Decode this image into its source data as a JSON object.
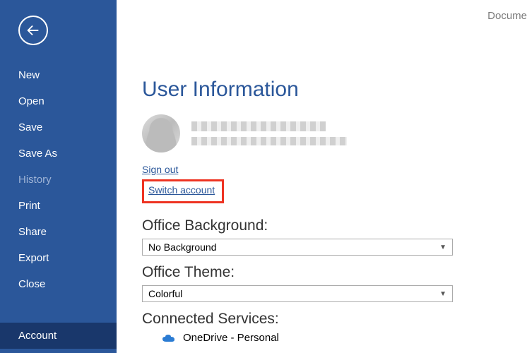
{
  "window": {
    "titleFragment": "Docume"
  },
  "sidebar": {
    "items": [
      {
        "label": "New"
      },
      {
        "label": "Open"
      },
      {
        "label": "Save"
      },
      {
        "label": "Save As"
      },
      {
        "label": "History"
      },
      {
        "label": "Print"
      },
      {
        "label": "Share"
      },
      {
        "label": "Export"
      },
      {
        "label": "Close"
      },
      {
        "label": "Account"
      }
    ]
  },
  "account": {
    "heading": "User Information",
    "signOut": "Sign out",
    "switchAccount": "Switch account",
    "backgroundLabel": "Office Background:",
    "backgroundValue": "No Background",
    "themeLabel": "Office Theme:",
    "themeValue": "Colorful",
    "connectedLabel": "Connected Services:",
    "service1": "OneDrive - Personal"
  },
  "colors": {
    "brand": "#2b579a",
    "highlight": "#e32"
  }
}
